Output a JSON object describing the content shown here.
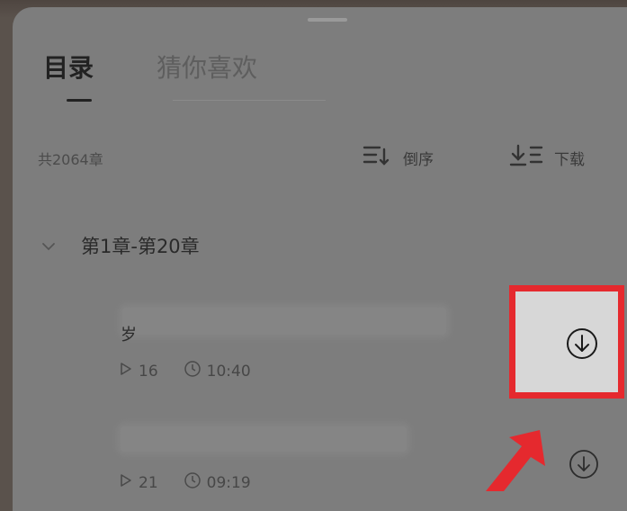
{
  "tabs": [
    {
      "label": "目录",
      "active": true
    },
    {
      "label": "猜你喜欢",
      "active": false
    }
  ],
  "summary": {
    "chapter_count": "共2064章"
  },
  "actions": {
    "sort": {
      "label": "倒序",
      "icon": "sort-reverse-icon"
    },
    "download": {
      "label": "下载",
      "icon": "download-list-icon"
    }
  },
  "volume": {
    "label": "第1章-第20章",
    "icon": "chevron-down-icon"
  },
  "chapters": [
    {
      "title_visible": "岁",
      "plays": "16",
      "duration": "10:40",
      "icon": "download-circle-icon"
    },
    {
      "title_visible": "",
      "plays": "21",
      "duration": "09:19",
      "icon": "download-circle-icon"
    }
  ],
  "annotations": {
    "highlight_color": "#e5292e",
    "arrow_color": "#e5292e"
  }
}
